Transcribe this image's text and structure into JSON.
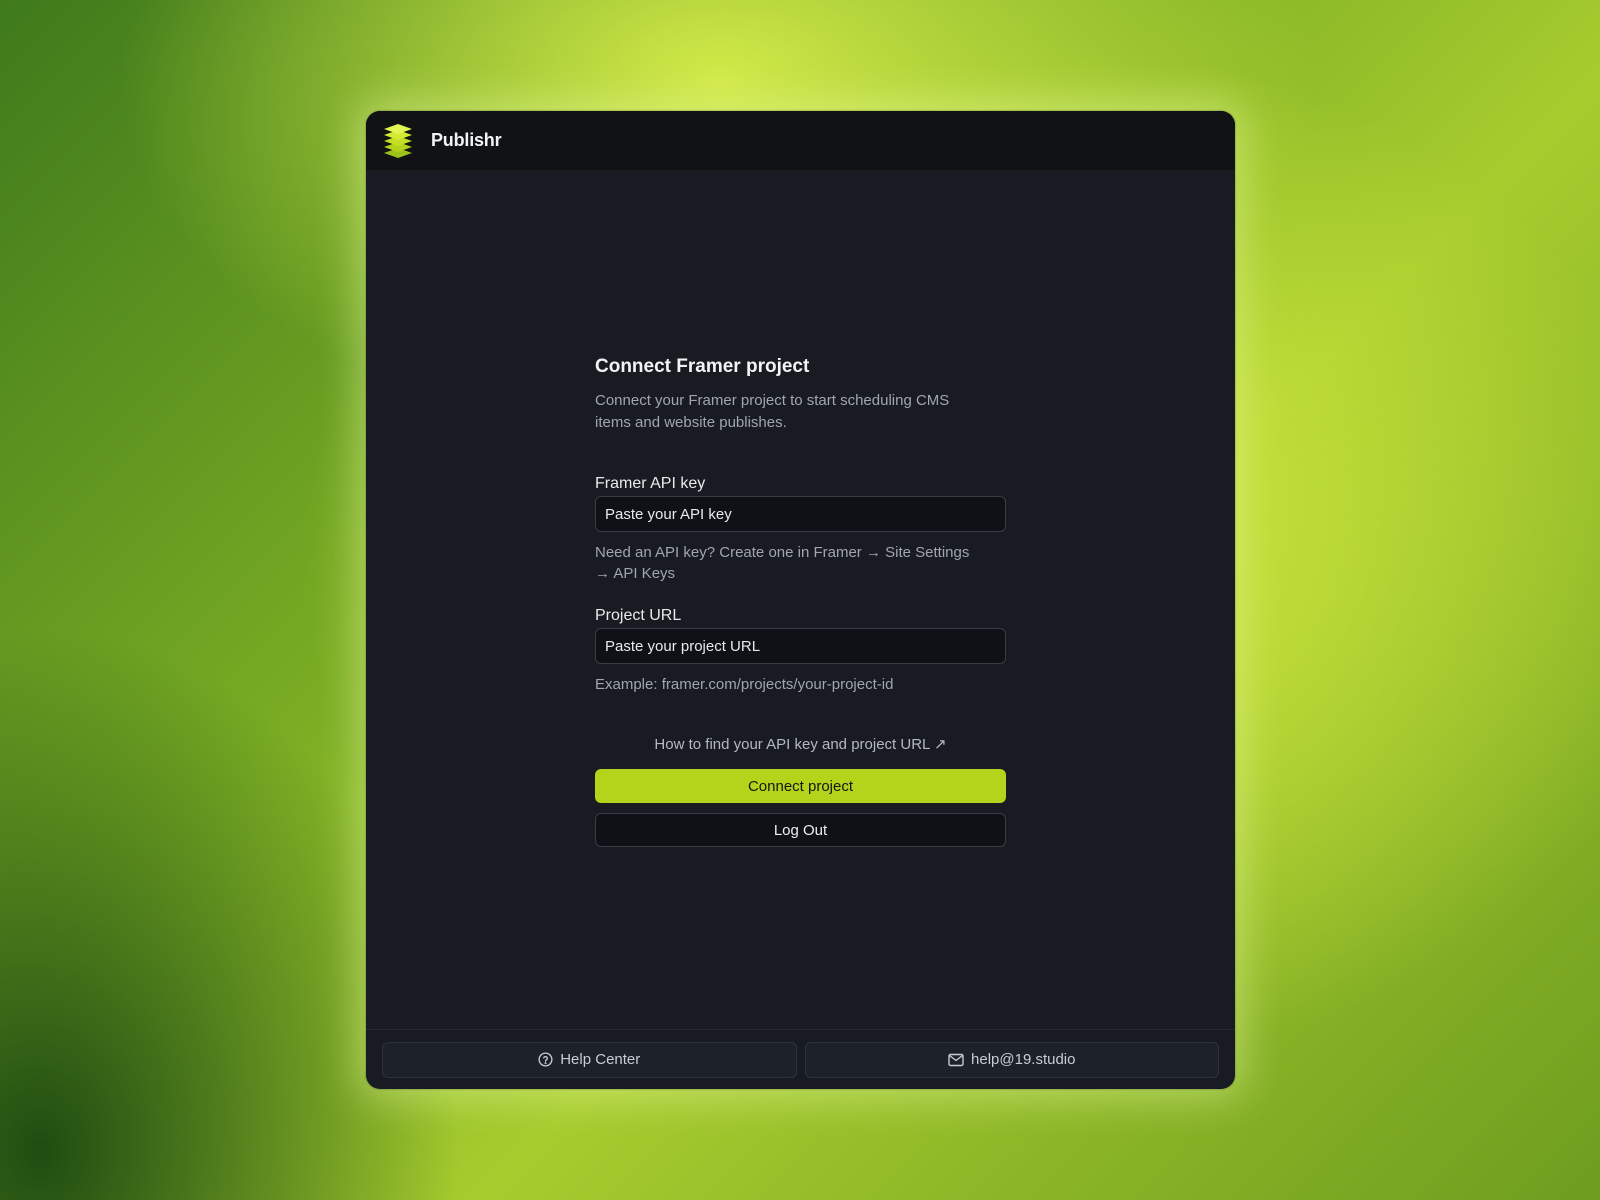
{
  "app": {
    "name": "Publishr",
    "logo_icon": "layers-stack-icon",
    "accent_color": "#b2d41a"
  },
  "form": {
    "title": "Connect Framer project",
    "description": "Connect your Framer project to start scheduling CMS items and website publishes.",
    "api_key": {
      "label": "Framer API key",
      "placeholder": "Paste your API key",
      "value": "",
      "hint": "Need an API key? Create one in Framer → Site Settings → API Keys"
    },
    "project_url": {
      "label": "Project URL",
      "placeholder": "Paste your project URL",
      "value": "",
      "hint": "Example: framer.com/projects/your-project-id"
    },
    "help_link": "How to find your API key and project URL ↗",
    "connect_label": "Connect project",
    "logout_label": "Log Out"
  },
  "footer": {
    "help_center": {
      "label": "Help Center",
      "icon": "question-circle-icon"
    },
    "email": {
      "label": "help@19.studio",
      "icon": "mail-icon"
    }
  }
}
